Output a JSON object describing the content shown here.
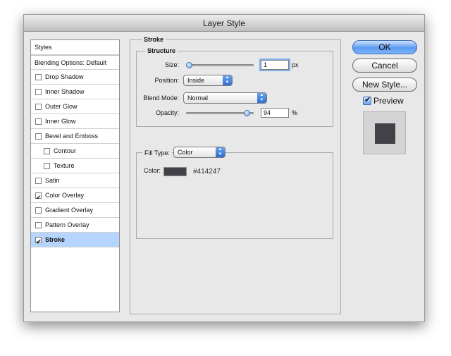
{
  "window": {
    "title": "Layer Style"
  },
  "sidebar": {
    "header": "Styles",
    "blending": "Blending Options: Default",
    "items": [
      {
        "label": "Drop Shadow",
        "checked": false,
        "indent": false,
        "selected": false
      },
      {
        "label": "Inner Shadow",
        "checked": false,
        "indent": false,
        "selected": false
      },
      {
        "label": "Outer Glow",
        "checked": false,
        "indent": false,
        "selected": false
      },
      {
        "label": "Inner Glow",
        "checked": false,
        "indent": false,
        "selected": false
      },
      {
        "label": "Bevel and Emboss",
        "checked": false,
        "indent": false,
        "selected": false
      },
      {
        "label": "Contour",
        "checked": false,
        "indent": true,
        "selected": false
      },
      {
        "label": "Texture",
        "checked": false,
        "indent": true,
        "selected": false
      },
      {
        "label": "Satin",
        "checked": false,
        "indent": false,
        "selected": false
      },
      {
        "label": "Color Overlay",
        "checked": true,
        "indent": false,
        "selected": false
      },
      {
        "label": "Gradient Overlay",
        "checked": false,
        "indent": false,
        "selected": false
      },
      {
        "label": "Pattern Overlay",
        "checked": false,
        "indent": false,
        "selected": false
      },
      {
        "label": "Stroke",
        "checked": true,
        "indent": false,
        "selected": true
      }
    ]
  },
  "stroke": {
    "section_title": "Stroke",
    "structure_title": "Structure",
    "size_label": "Size:",
    "size_value": "1",
    "size_unit": "px",
    "size_fraction": 0.0,
    "position_label": "Position:",
    "position_value": "Inside",
    "blend_label": "Blend Mode:",
    "blend_value": "Normal",
    "opacity_label": "Opacity:",
    "opacity_value": "94",
    "opacity_unit": "%",
    "opacity_fraction": 0.94,
    "filltype_label": "Fill Type:",
    "filltype_value": "Color",
    "color_label": "Color:",
    "color_hex": "#414247"
  },
  "buttons": {
    "ok": "OK",
    "cancel": "Cancel",
    "new_style": "New Style...",
    "preview": "Preview"
  },
  "colors": {
    "stroke_color": "#414247",
    "selection": "#b5d5ff",
    "accent": "#5c9af0"
  }
}
